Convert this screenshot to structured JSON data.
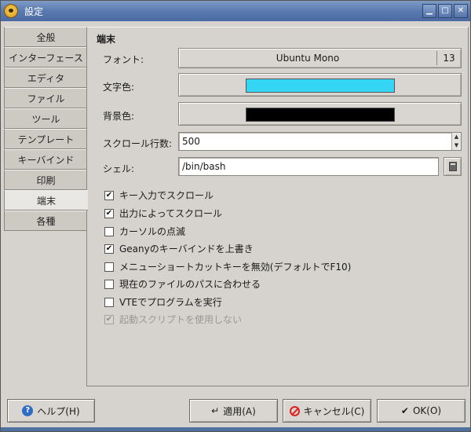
{
  "window": {
    "title": "設定"
  },
  "sidebar": {
    "tabs": [
      {
        "label": "全般"
      },
      {
        "label": "インターフェース"
      },
      {
        "label": "エディタ"
      },
      {
        "label": "ファイル"
      },
      {
        "label": "ツール"
      },
      {
        "label": "テンプレート"
      },
      {
        "label": "キーバインド"
      },
      {
        "label": "印刷"
      },
      {
        "label": "端末",
        "active": true
      },
      {
        "label": "各種"
      }
    ]
  },
  "terminal": {
    "section_title": "端末",
    "font_label": "フォント:",
    "font_name": "Ubuntu Mono",
    "font_size": "13",
    "fg_label": "文字色:",
    "fg_color": "#35d5f5",
    "bg_label": "背景色:",
    "bg_color": "#000000",
    "scroll_label": "スクロール行数:",
    "scroll_value": "500",
    "shell_label": "シェル:",
    "shell_value": "/bin/bash",
    "options": [
      {
        "label": "キー入力でスクロール",
        "checked": true,
        "enabled": true
      },
      {
        "label": "出力によってスクロール",
        "checked": true,
        "enabled": true
      },
      {
        "label": "カーソルの点滅",
        "checked": false,
        "enabled": true
      },
      {
        "label": "Geanyのキーバインドを上書き",
        "checked": true,
        "enabled": true
      },
      {
        "label": "メニューショートカットキーを無効(デフォルトでF10)",
        "checked": false,
        "enabled": true
      },
      {
        "label": "現在のファイルのパスに合わせる",
        "checked": false,
        "enabled": true
      },
      {
        "label": "VTEでプログラムを実行",
        "checked": false,
        "enabled": true
      },
      {
        "label": "起動スクリプトを使用しない",
        "checked": true,
        "enabled": false
      }
    ]
  },
  "buttons": {
    "help": "ヘルプ(H)",
    "apply": "適用(A)",
    "cancel": "キャンセル(C)",
    "ok": "OK(O)"
  },
  "icons": {
    "app": "geany-icon",
    "help": "help-icon",
    "apply": "apply-icon",
    "cancel": "cancel-icon",
    "ok": "checkmark-icon",
    "browse": "file-open-icon"
  }
}
